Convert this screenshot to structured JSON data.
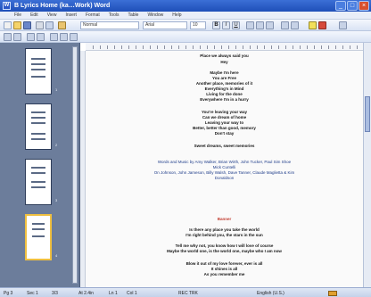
{
  "window": {
    "title": "B Lyrics Home (ka…Work) Word"
  },
  "menu": [
    "File",
    "Edit",
    "View",
    "Insert",
    "Format",
    "Tools",
    "Table",
    "Window",
    "Help"
  ],
  "toolbar": {
    "style_value": "Normal",
    "font_value": "Arial",
    "size_value": "10"
  },
  "document": {
    "lines": [
      {
        "text": "Place      we always said you",
        "style": "b"
      },
      {
        "text": "Hey",
        "style": "b"
      },
      {
        "text": "Maybe I'm here",
        "style": "b"
      },
      {
        "text": "You are Free",
        "style": "b"
      },
      {
        "text": "Another place, memories of it",
        "style": "b"
      },
      {
        "text": "Everything's in Mind",
        "style": "b"
      },
      {
        "text": "Living for the done",
        "style": "b"
      },
      {
        "text": "Everywhere I'm in a hurry",
        "style": "b"
      },
      {
        "text": "You're leaving your way",
        "style": "b"
      },
      {
        "text": "Can we dream of home",
        "style": "b"
      },
      {
        "text": "Leaving your way to",
        "style": "b"
      },
      {
        "text": "Better, better than good, memory",
        "style": "b"
      },
      {
        "text": "Don't stay",
        "style": "b"
      },
      {
        "text": "Sweet dreams, sweet memories",
        "style": "b"
      },
      {
        "text": "Words and Music by Amy Walker, Brian Wirth, John Tucker, Paul Sim Shoe",
        "style": "blue"
      },
      {
        "text": "Mick Cuntelli",
        "style": "blue"
      },
      {
        "text": "On Johnson, John Jameson, Billy Walsh, Dave Tanner, Claude Maglietta & Kim",
        "style": "blue"
      },
      {
        "text": "Donaldson",
        "style": "blue"
      },
      {
        "text": "Banner",
        "style": "red"
      },
      {
        "text": "Is there any place you take the world",
        "style": "b"
      },
      {
        "text": "I'm right behind you, the stars in the sun",
        "style": "b"
      },
      {
        "text": "Tell me why not, you know how I will love of course",
        "style": "b"
      },
      {
        "text": "Maybe the world one, is the world one, maybe who I am now",
        "style": "b"
      },
      {
        "text": "Blow it out of my love forever, ever is all",
        "style": "b"
      },
      {
        "text": "It shines is all",
        "style": "b"
      },
      {
        "text": "As you remember me",
        "style": "b"
      }
    ]
  },
  "statusbar": {
    "page": "Pg 3",
    "section": "Sec 1",
    "page_of": "3/3",
    "at": "At 2.4in",
    "ln": "Ln 1",
    "col": "Col 1",
    "rec": "REC TRK",
    "language": "English (U.S.)"
  },
  "thumbnails": [
    "1",
    "2",
    "3",
    "4"
  ]
}
